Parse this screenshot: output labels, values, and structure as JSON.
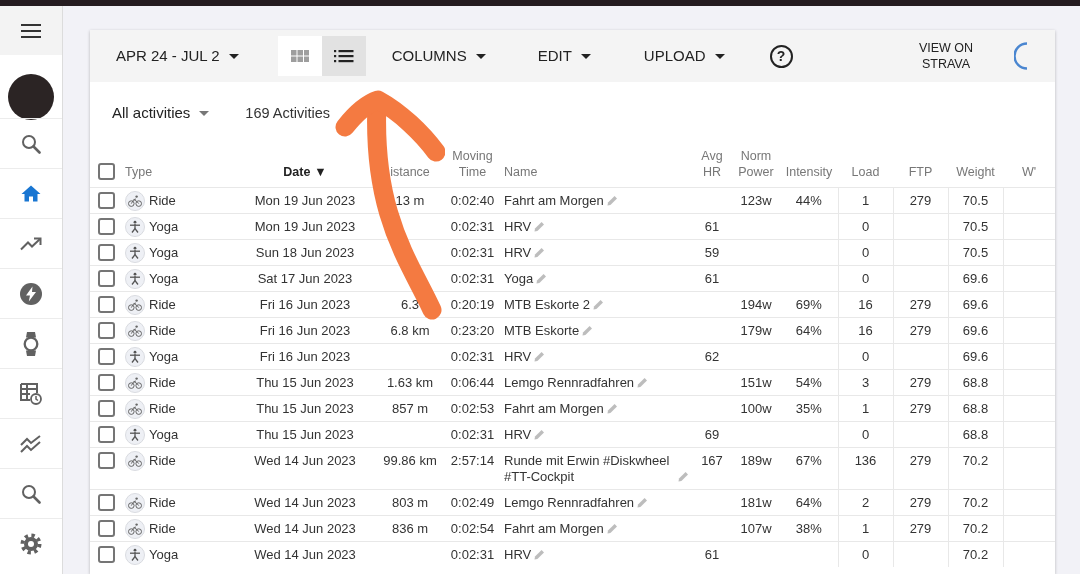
{
  "sidebar": {
    "items": [
      {
        "kind": "search",
        "selected": false
      },
      {
        "kind": "home",
        "selected": true
      },
      {
        "kind": "trend",
        "selected": false
      },
      {
        "kind": "bolt",
        "selected": false
      },
      {
        "kind": "watch",
        "selected": false
      },
      {
        "kind": "schedule",
        "selected": false
      },
      {
        "kind": "multiline",
        "selected": false
      },
      {
        "kind": "search",
        "selected": false
      },
      {
        "kind": "settings",
        "selected": false
      }
    ]
  },
  "toolbar": {
    "date_range": "APR 24 - JUL 2",
    "view_toggle": [
      {
        "kind": "grid",
        "selected": false
      },
      {
        "kind": "list",
        "selected": true
      }
    ],
    "menus": [
      "COLUMNS",
      "EDIT",
      "UPLOAD"
    ],
    "help": "?",
    "strava_link": "VIEW ON STRAVA",
    "loading": true
  },
  "filter": {
    "activity_type": "All activities",
    "count": "169 Activities"
  },
  "table": {
    "select_all": {
      "checked": false
    },
    "columns": [
      {
        "label": "Type",
        "sorted": false
      },
      {
        "label": "Date",
        "sorted": true,
        "sort_arrow": "▼"
      },
      {
        "label": "istance",
        "sorted": false
      },
      {
        "label": "Moving Time",
        "sorted": false
      },
      {
        "label": "Name",
        "sorted": false
      },
      {
        "label": "Avg HR",
        "sorted": false
      },
      {
        "label": "Norm Power",
        "sorted": false
      },
      {
        "label": "Intensity",
        "sorted": false
      },
      {
        "label": "Load",
        "sorted": false
      },
      {
        "label": "FTP",
        "sorted": false
      },
      {
        "label": "Weight",
        "sorted": false
      },
      {
        "label": "W'",
        "sorted": false
      }
    ],
    "rows": [
      {
        "checked": false,
        "kind": "ride",
        "type": "Ride",
        "date": "Mon 19 Jun 2023",
        "distance": "13 m",
        "moving_time": "0:02:40",
        "name": "Fahrt am Morgen",
        "norm_power": "123w",
        "intensity": "44%",
        "load": "1",
        "ftp": "279",
        "weight": "70.5"
      },
      {
        "checked": false,
        "kind": "yoga",
        "type": "Yoga",
        "date": "Mon 19 Jun 2023",
        "moving_time": "0:02:31",
        "name": "HRV",
        "avg_hr": "61",
        "load": "0",
        "weight": "70.5"
      },
      {
        "checked": false,
        "kind": "yoga",
        "type": "Yoga",
        "date": "Sun 18 Jun 2023",
        "moving_time": "0:02:31",
        "name": "HRV",
        "avg_hr": "59",
        "load": "0",
        "weight": "70.5"
      },
      {
        "checked": false,
        "kind": "yoga",
        "type": "Yoga",
        "date": "Sat 17 Jun 2023",
        "moving_time": "0:02:31",
        "name": "Yoga",
        "avg_hr": "61",
        "load": "0",
        "weight": "69.6"
      },
      {
        "checked": false,
        "kind": "ride",
        "type": "Ride",
        "date": "Fri 16 Jun 2023",
        "distance": "6.3",
        "moving_time": "0:20:19",
        "name": "MTB Eskorte 2",
        "norm_power": "194w",
        "intensity": "69%",
        "load": "16",
        "ftp": "279",
        "weight": "69.6"
      },
      {
        "checked": false,
        "kind": "ride",
        "type": "Ride",
        "date": "Fri 16 Jun 2023",
        "distance": "6.8 km",
        "moving_time": "0:23:20",
        "name": "MTB Eskorte",
        "norm_power": "179w",
        "intensity": "64%",
        "load": "16",
        "ftp": "279",
        "weight": "69.6"
      },
      {
        "checked": false,
        "kind": "yoga",
        "type": "Yoga",
        "date": "Fri 16 Jun 2023",
        "moving_time": "0:02:31",
        "name": "HRV",
        "avg_hr": "62",
        "load": "0",
        "weight": "69.6"
      },
      {
        "checked": false,
        "kind": "ride",
        "type": "Ride",
        "date": "Thu 15 Jun 2023",
        "distance": "1.63 km",
        "moving_time": "0:06:44",
        "name": "Lemgo Rennradfahren",
        "norm_power": "151w",
        "intensity": "54%",
        "load": "3",
        "ftp": "279",
        "weight": "68.8"
      },
      {
        "checked": false,
        "kind": "ride",
        "type": "Ride",
        "date": "Thu 15 Jun 2023",
        "distance": "857 m",
        "moving_time": "0:02:53",
        "name": "Fahrt am Morgen",
        "norm_power": "100w",
        "intensity": "35%",
        "load": "1",
        "ftp": "279",
        "weight": "68.8"
      },
      {
        "checked": false,
        "kind": "yoga",
        "type": "Yoga",
        "date": "Thu 15 Jun 2023",
        "moving_time": "0:02:31",
        "name": "HRV",
        "avg_hr": "69",
        "load": "0",
        "weight": "68.8"
      },
      {
        "checked": false,
        "kind": "ride",
        "type": "Ride",
        "date": "Wed 14 Jun 2023",
        "distance": "99.86 km",
        "moving_time": "2:57:14",
        "name": "Runde mit Erwin #Diskwheel #TT-Cockpit",
        "avg_hr": "167",
        "norm_power": "189w",
        "intensity": "67%",
        "load": "136",
        "ftp": "279",
        "weight": "70.2"
      },
      {
        "checked": false,
        "kind": "ride",
        "type": "Ride",
        "date": "Wed 14 Jun 2023",
        "distance": "803 m",
        "moving_time": "0:02:49",
        "name": "Lemgo Rennradfahren",
        "norm_power": "181w",
        "intensity": "64%",
        "load": "2",
        "ftp": "279",
        "weight": "70.2"
      },
      {
        "checked": false,
        "kind": "ride",
        "type": "Ride",
        "date": "Wed 14 Jun 2023",
        "distance": "836 m",
        "moving_time": "0:02:54",
        "name": "Fahrt am Morgen",
        "norm_power": "107w",
        "intensity": "38%",
        "load": "1",
        "ftp": "279",
        "weight": "70.2"
      },
      {
        "checked": false,
        "kind": "yoga",
        "type": "Yoga",
        "date": "Wed 14 Jun 2023",
        "moving_time": "0:02:31",
        "name": "HRV",
        "avg_hr": "61",
        "load": "0",
        "weight": "70.2"
      }
    ]
  }
}
